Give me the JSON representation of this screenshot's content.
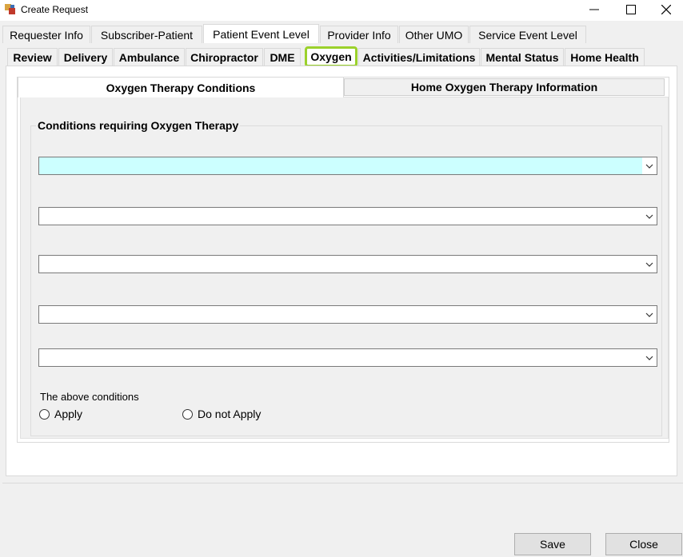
{
  "window": {
    "title": "Create Request",
    "controls": {
      "minimize": "—",
      "maximize": "☐",
      "close": "✕"
    }
  },
  "tabs_row1": [
    "Requester Info",
    "Subscriber-Patient",
    "Patient Event Level",
    "Provider Info",
    "Other UMO",
    "Service Event Level"
  ],
  "tabs_row1_active": "Patient Event Level",
  "tabs_row2": [
    "Review",
    "Delivery",
    "Ambulance",
    "Chiropractor",
    "DME",
    "Oxygen",
    "Activities/Limitations",
    "Mental Status",
    "Home Health"
  ],
  "tabs_row2_active": "Oxygen",
  "subtabs": [
    "Oxygen Therapy Conditions",
    "Home Oxygen Therapy Information"
  ],
  "subtabs_active": "Oxygen Therapy Conditions",
  "group": {
    "title": "Conditions requiring Oxygen Therapy"
  },
  "conditions": [
    "",
    "",
    "",
    "",
    ""
  ],
  "above_conditions": {
    "label": "The above conditions",
    "options": [
      "Apply",
      "Do not Apply"
    ],
    "selected": null
  },
  "buttons": {
    "save": "Save",
    "close": "Close"
  },
  "colors": {
    "highlight": "#9bd12b",
    "focused_field": "#ccffff"
  }
}
